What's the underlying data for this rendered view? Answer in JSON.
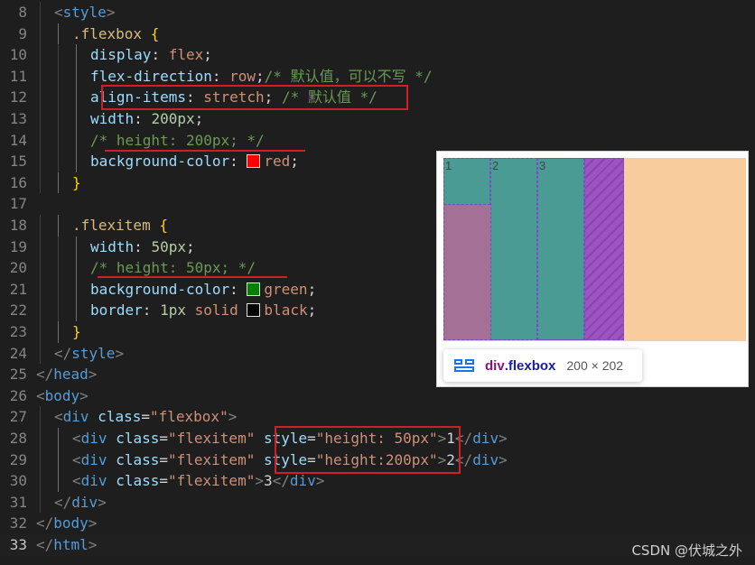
{
  "editor": {
    "lines": [
      {
        "n": "8",
        "i": 1,
        "tokens": [
          [
            "t-punc",
            "<"
          ],
          [
            "t-tag",
            "style"
          ],
          [
            "t-punc",
            ">"
          ]
        ]
      },
      {
        "n": "9",
        "i": 2,
        "tokens": [
          [
            "t-sel",
            ".flexbox "
          ],
          [
            "t-brace",
            "{"
          ]
        ]
      },
      {
        "n": "10",
        "i": 3,
        "tokens": [
          [
            "t-prop",
            "display"
          ],
          [
            "t-text",
            ": "
          ],
          [
            "t-val",
            "flex"
          ],
          [
            "t-text",
            ";"
          ]
        ]
      },
      {
        "n": "11",
        "i": 3,
        "tokens": [
          [
            "t-prop",
            "flex-direction"
          ],
          [
            "t-text",
            ": "
          ],
          [
            "t-val",
            "row"
          ],
          [
            "t-text",
            ";"
          ],
          [
            "t-com",
            "/* 默认值，可以不写 */"
          ]
        ]
      },
      {
        "n": "12",
        "i": 3,
        "tokens": [
          [
            "t-prop",
            "align-items"
          ],
          [
            "t-text",
            ": "
          ],
          [
            "t-val",
            "stretch"
          ],
          [
            "t-text",
            "; "
          ],
          [
            "t-com",
            "/* 默认值 */"
          ]
        ]
      },
      {
        "n": "13",
        "i": 3,
        "tokens": [
          [
            "t-prop",
            "width"
          ],
          [
            "t-text",
            ": "
          ],
          [
            "t-num",
            "200px"
          ],
          [
            "t-text",
            ";"
          ]
        ]
      },
      {
        "n": "14",
        "i": 3,
        "tokens": [
          [
            "t-com",
            "/* height: 200px; */"
          ]
        ]
      },
      {
        "n": "15",
        "i": 3,
        "tokens": [
          [
            "t-prop",
            "background-color"
          ],
          [
            "t-text",
            ": "
          ],
          [
            "swatch",
            "#ff0000"
          ],
          [
            "t-val",
            "red"
          ],
          [
            "t-text",
            ";"
          ]
        ]
      },
      {
        "n": "16",
        "i": 2,
        "tokens": [
          [
            "t-brace",
            "}"
          ]
        ]
      },
      {
        "n": "17",
        "i": 0,
        "tokens": []
      },
      {
        "n": "18",
        "i": 2,
        "tokens": [
          [
            "t-sel",
            ".flexitem "
          ],
          [
            "t-brace",
            "{"
          ]
        ]
      },
      {
        "n": "19",
        "i": 3,
        "tokens": [
          [
            "t-prop",
            "width"
          ],
          [
            "t-text",
            ": "
          ],
          [
            "t-num",
            "50px"
          ],
          [
            "t-text",
            ";"
          ]
        ]
      },
      {
        "n": "20",
        "i": 3,
        "tokens": [
          [
            "t-com",
            "/* height: 50px; */"
          ]
        ]
      },
      {
        "n": "21",
        "i": 3,
        "tokens": [
          [
            "t-prop",
            "background-color"
          ],
          [
            "t-text",
            ": "
          ],
          [
            "swatch",
            "#008000"
          ],
          [
            "t-val",
            "green"
          ],
          [
            "t-text",
            ";"
          ]
        ]
      },
      {
        "n": "22",
        "i": 3,
        "tokens": [
          [
            "t-prop",
            "border"
          ],
          [
            "t-text",
            ": "
          ],
          [
            "t-num",
            "1px"
          ],
          [
            "t-text",
            " "
          ],
          [
            "t-val",
            "solid"
          ],
          [
            "t-text",
            " "
          ],
          [
            "swatch",
            "#000000"
          ],
          [
            "t-val",
            "black"
          ],
          [
            "t-text",
            ";"
          ]
        ]
      },
      {
        "n": "23",
        "i": 2,
        "tokens": [
          [
            "t-brace",
            "}"
          ]
        ]
      },
      {
        "n": "24",
        "i": 1,
        "tokens": [
          [
            "t-punc",
            "</"
          ],
          [
            "t-tag",
            "style"
          ],
          [
            "t-punc",
            ">"
          ]
        ]
      },
      {
        "n": "25",
        "i": 0,
        "tokens": [
          [
            "t-punc",
            "</"
          ],
          [
            "t-tag",
            "head"
          ],
          [
            "t-punc",
            ">"
          ]
        ]
      },
      {
        "n": "26",
        "i": 0,
        "tokens": [
          [
            "t-punc",
            "<"
          ],
          [
            "t-tag",
            "body"
          ],
          [
            "t-punc",
            ">"
          ]
        ]
      },
      {
        "n": "27",
        "i": 1,
        "tokens": [
          [
            "t-punc",
            "<"
          ],
          [
            "t-tag",
            "div"
          ],
          [
            "t-text",
            " "
          ],
          [
            "t-attr",
            "class"
          ],
          [
            "t-text",
            "="
          ],
          [
            "t-str",
            "\"flexbox\""
          ],
          [
            "t-punc",
            ">"
          ]
        ]
      },
      {
        "n": "28",
        "i": 2,
        "tokens": [
          [
            "t-punc",
            "<"
          ],
          [
            "t-tag",
            "div"
          ],
          [
            "t-text",
            " "
          ],
          [
            "t-attr",
            "class"
          ],
          [
            "t-text",
            "="
          ],
          [
            "t-str",
            "\"flexitem\""
          ],
          [
            "t-text",
            " "
          ],
          [
            "t-attr",
            "style"
          ],
          [
            "t-text",
            "="
          ],
          [
            "t-str",
            "\"height: 50px\""
          ],
          [
            "t-punc",
            ">"
          ],
          [
            "t-text",
            "1"
          ],
          [
            "t-punc",
            "</"
          ],
          [
            "t-tag",
            "div"
          ],
          [
            "t-punc",
            ">"
          ]
        ]
      },
      {
        "n": "29",
        "i": 2,
        "tokens": [
          [
            "t-punc",
            "<"
          ],
          [
            "t-tag",
            "div"
          ],
          [
            "t-text",
            " "
          ],
          [
            "t-attr",
            "class"
          ],
          [
            "t-text",
            "="
          ],
          [
            "t-str",
            "\"flexitem\""
          ],
          [
            "t-text",
            " "
          ],
          [
            "t-attr",
            "style"
          ],
          [
            "t-text",
            "="
          ],
          [
            "t-str",
            "\"height:200px\""
          ],
          [
            "t-punc",
            ">"
          ],
          [
            "t-text",
            "2"
          ],
          [
            "t-punc",
            "</"
          ],
          [
            "t-tag",
            "div"
          ],
          [
            "t-punc",
            ">"
          ]
        ]
      },
      {
        "n": "30",
        "i": 2,
        "tokens": [
          [
            "t-punc",
            "<"
          ],
          [
            "t-tag",
            "div"
          ],
          [
            "t-text",
            " "
          ],
          [
            "t-attr",
            "class"
          ],
          [
            "t-text",
            "="
          ],
          [
            "t-str",
            "\"flexitem\""
          ],
          [
            "t-punc",
            ">"
          ],
          [
            "t-text",
            "3"
          ],
          [
            "t-punc",
            "</"
          ],
          [
            "t-tag",
            "div"
          ],
          [
            "t-punc",
            ">"
          ]
        ]
      },
      {
        "n": "31",
        "i": 1,
        "tokens": [
          [
            "t-punc",
            "</"
          ],
          [
            "t-tag",
            "div"
          ],
          [
            "t-punc",
            ">"
          ]
        ]
      },
      {
        "n": "32",
        "i": 0,
        "tokens": [
          [
            "t-punc",
            "</"
          ],
          [
            "t-tag",
            "body"
          ],
          [
            "t-punc",
            ">"
          ]
        ]
      },
      {
        "n": "33",
        "i": 0,
        "active": true,
        "tokens": [
          [
            "t-punc",
            "</"
          ],
          [
            "t-tag",
            "html"
          ],
          [
            "t-punc",
            ">"
          ]
        ]
      }
    ]
  },
  "preview": {
    "item_labels": [
      "1",
      "2",
      "3"
    ],
    "tooltip": {
      "tag": "div",
      "class": ".flexbox",
      "size": "200 × 202"
    }
  },
  "watermark": "CSDN @伏城之外"
}
